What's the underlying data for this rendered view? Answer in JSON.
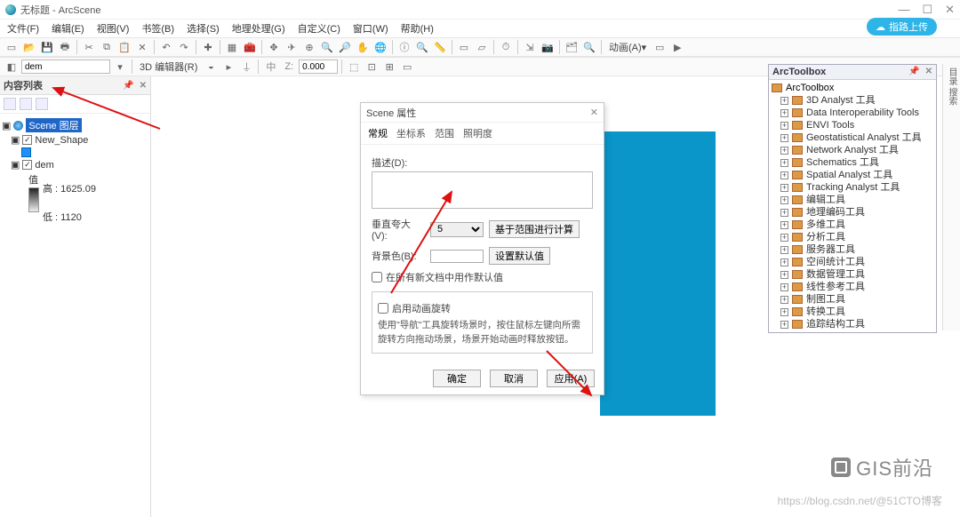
{
  "app": {
    "title": "无标题 - ArcScene"
  },
  "menu": [
    "文件(F)",
    "编辑(E)",
    "视图(V)",
    "书签(B)",
    "选择(S)",
    "地理处理(G)",
    "自定义(C)",
    "窗口(W)",
    "帮助(H)"
  ],
  "pill": "指路上传",
  "toolbar2": {
    "layerSel": "dem",
    "editorLabel": "3D 编辑器(R)",
    "animLabel": "动画(A)▾",
    "coords": "0.000"
  },
  "toc": {
    "title": "内容列表",
    "scene": "Scene 图层",
    "layers": [
      {
        "name": "New_Shape",
        "checked": true
      },
      {
        "name": "dem",
        "checked": true
      }
    ],
    "legend": {
      "label": "值",
      "high": "高 : 1625.09",
      "low": "低 : 1120"
    }
  },
  "arctoolbox": {
    "title": "ArcToolbox",
    "root": "ArcToolbox",
    "items": [
      "3D Analyst 工具",
      "Data Interoperability Tools",
      "ENVI Tools",
      "Geostatistical Analyst 工具",
      "Network Analyst 工具",
      "Schematics 工具",
      "Spatial Analyst 工具",
      "Tracking Analyst 工具",
      "编辑工具",
      "地理编码工具",
      "多维工具",
      "分析工具",
      "服务器工具",
      "空间统计工具",
      "数据管理工具",
      "线性参考工具",
      "制图工具",
      "转换工具",
      "追踪结构工具"
    ]
  },
  "dialog": {
    "title": "Scene 属性",
    "tabs": [
      "常规",
      "坐标系",
      "范围",
      "照明度"
    ],
    "descLabel": "描述(D):",
    "desc": "",
    "zoomLabel": "垂直夸大(V):",
    "zoomValue": "5",
    "calcBtn": "基于范围进行计算",
    "bgLabel": "背景色(B):",
    "resetBtn": "设置默认值",
    "chkAllDocs": "在所有新文档中用作默认值",
    "chkAnim": "启用动画旋转",
    "animHint": "使用\"导航\"工具旋转场景时，按住鼠标左键向所需旋转方向拖动场景，场景开始动画时释放按钮。",
    "ok": "确定",
    "cancel": "取消",
    "apply": "应用(A)"
  },
  "watermark": "GIS前沿",
  "footer": "https://blog.csdn.net/@51CTO博客"
}
